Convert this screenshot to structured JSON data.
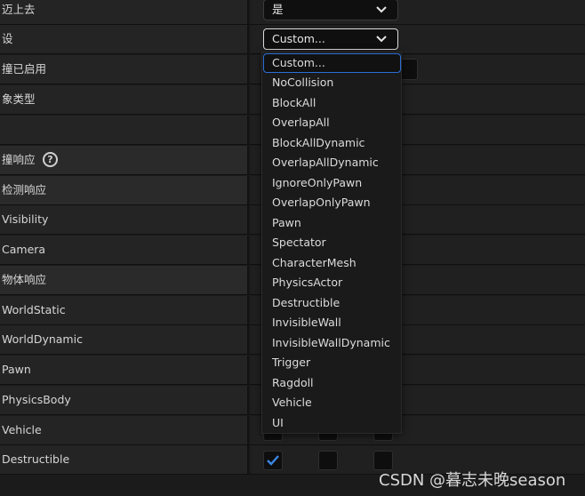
{
  "rows": [
    {
      "label": "迈上去",
      "combo_value": "是"
    },
    {
      "label": "设",
      "combo_value": "Custom..."
    },
    {
      "label": "撞已启用"
    },
    {
      "label": "象类型"
    },
    {
      "label": ""
    },
    {
      "label": "撞响应"
    },
    {
      "label": "检测响应"
    },
    {
      "label": "Visibility"
    },
    {
      "label": "Camera"
    },
    {
      "label": "物体响应"
    },
    {
      "label": "WorldStatic"
    },
    {
      "label": "WorldDynamic"
    },
    {
      "label": "Pawn"
    },
    {
      "label": "PhysicsBody"
    },
    {
      "label": "Vehicle"
    },
    {
      "label": "Destructible"
    }
  ],
  "help_glyph": "?",
  "dropdown": {
    "selected": "Custom...",
    "options": [
      "Custom...",
      "NoCollision",
      "BlockAll",
      "OverlapAll",
      "BlockAllDynamic",
      "OverlapAllDynamic",
      "IgnoreOnlyPawn",
      "OverlapOnlyPawn",
      "Pawn",
      "Spectator",
      "CharacterMesh",
      "PhysicsActor",
      "Destructible",
      "InvisibleWall",
      "InvisibleWallDynamic",
      "Trigger",
      "Ragdoll",
      "Vehicle",
      "UI"
    ]
  },
  "destructible_checks": [
    true,
    false,
    false
  ],
  "colors": {
    "accent": "#2a6fd6",
    "check": "#3b86e8"
  },
  "watermark": "CSDN @暮志未晚season"
}
